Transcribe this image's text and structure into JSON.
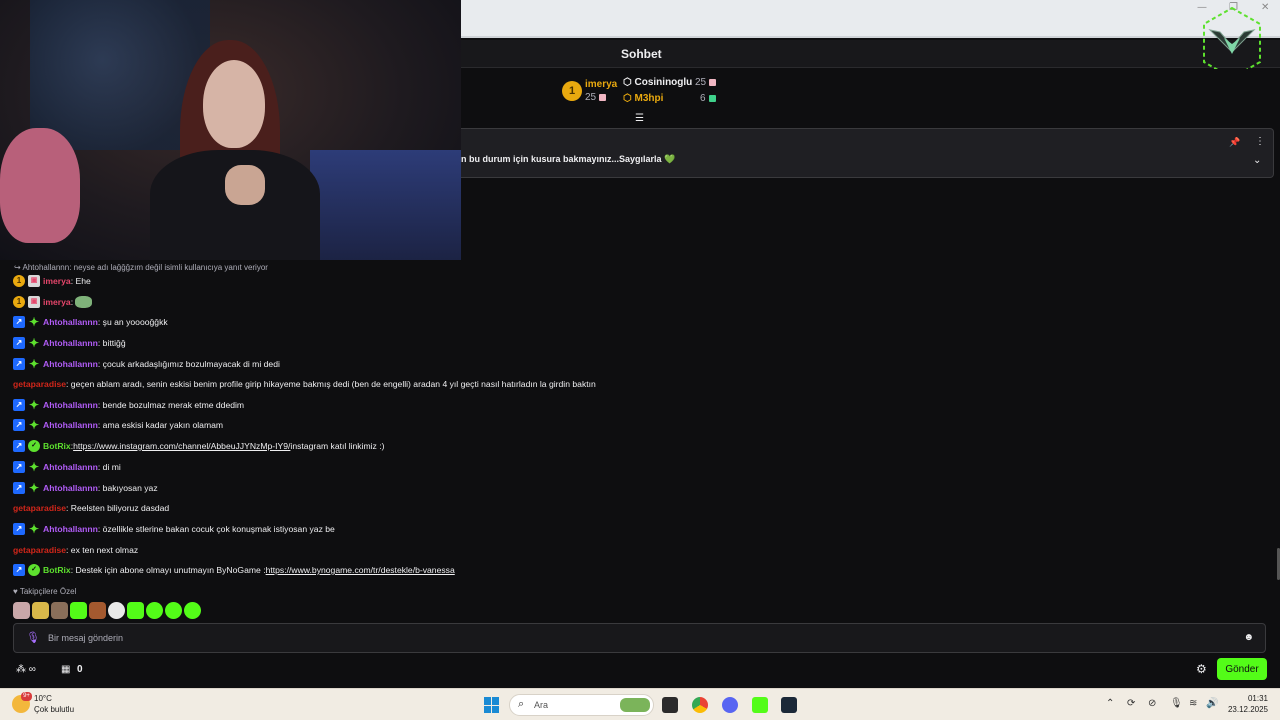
{
  "window": {
    "minimize_glyph": "—",
    "maximize_glyph": "❐",
    "close_glyph": "✕"
  },
  "chat": {
    "title": "Sohbet",
    "leaderboard": {
      "first": {
        "rank": "1",
        "name": "imerya",
        "count": "25",
        "color": "#e9a90f"
      },
      "second": {
        "name": "Cosininoglu",
        "count": "25",
        "color": "#efeff1"
      },
      "third": {
        "name": "M3hpi",
        "count": "6",
        "color": "#e9a90f"
      }
    },
    "pinned_message": "n bu durum için kusura bakmayınız...Saygılarla 💚",
    "reply_context": "↪ Ahtohallannn: neyse adı lağğğzım değil isimli kullanıcıya yanıt veriyor",
    "messages": [
      {
        "user": "imerya",
        "text": ": Ehe"
      },
      {
        "user": "imerya",
        "text": ":"
      },
      {
        "user": "Ahtohallannn",
        "text": ": şu an yooooğğkk"
      },
      {
        "user": "Ahtohallannn",
        "text": ": bittiğğ"
      },
      {
        "user": "Ahtohallannn",
        "text": ": çocuk arkadaşlığımız bozulmayacak di mi dedi"
      },
      {
        "user": "getaparadise",
        "text": ": geçen ablam aradı, senin eskisi benim profile girip hikayeme bakmış dedi (ben de engelli) aradan 4 yıl geçti nasıl hatırladın la girdin baktın"
      },
      {
        "user": "Ahtohallannn",
        "text": ": bende bozulmaz merak etme ddedim"
      },
      {
        "user": "Ahtohallannn",
        "text": ": ama eskisi kadar yakın olamam"
      },
      {
        "user": "BotRix",
        "text_prefix": ": ",
        "link": "https://www.instagram.com/channel/AbbeuJJYNzMp-IY9/",
        "text_suffix": " instagram katıl linkimiz :)"
      },
      {
        "user": "Ahtohallannn",
        "text": ": di mi"
      },
      {
        "user": "Ahtohallannn",
        "text": ": bakıyosan yaz"
      },
      {
        "user": "getaparadise",
        "text": ": Reelsten biliyoruz dasdad"
      },
      {
        "user": "Ahtohallannn",
        "text": ": özellikle stlerine bakan cocuk çok konuşmak istiyosan yaz be"
      },
      {
        "user": "getaparadise",
        "text": ": ex ten next olmaz"
      },
      {
        "user": "BotRix",
        "text_prefix": ": Destek için abone olmayı unutmayın ByNoGame : ",
        "link": "https://www.bynogame.com/tr/destekle/b-vanessa",
        "text_suffix": ""
      }
    ],
    "followers_only": "♥ Takipçilere Özel",
    "input_placeholder": "Bir mesaj gönderin",
    "points_label": "∞",
    "store_count": "0",
    "send_label": "Gönder"
  },
  "taskbar": {
    "temperature": "10°C",
    "condition": "Çok bulutlu",
    "weather_badge": "9+",
    "search_placeholder": "Ara",
    "time": "01:31",
    "date": "23.12.2025"
  },
  "colors": {
    "accent": "#53fc18",
    "vip": "#1e69ff",
    "purple_user": "#b15cf7",
    "pink_user": "#e5466b",
    "red_user": "#d1261a",
    "bot_user": "#5de12e"
  }
}
